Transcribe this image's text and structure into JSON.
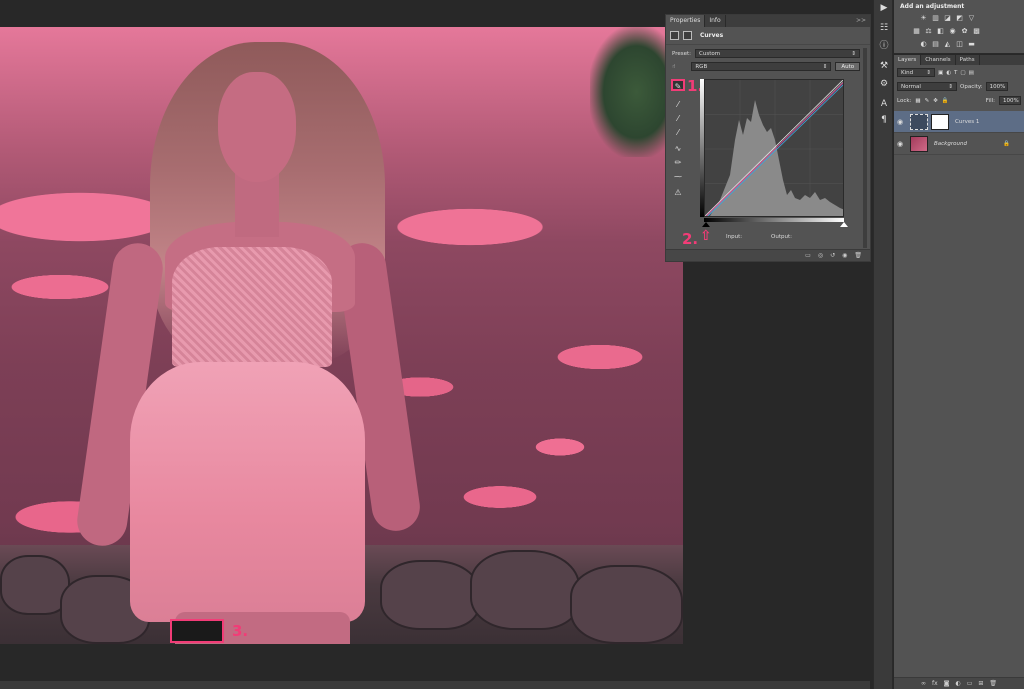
{
  "properties_panel": {
    "tabs": [
      "Properties",
      "Info"
    ],
    "collapse_icon": ">>",
    "menu_icon": "≡",
    "title": "Curves",
    "preset_label": "Preset:",
    "preset_value": "Custom",
    "channel_value": "RGB",
    "auto_button": "Auto",
    "input_label": "Input:",
    "output_label": "Output:",
    "tools": [
      "adjust-on-image-icon",
      "black-point-eyedropper-icon",
      "gray-point-eyedropper-icon",
      "white-point-eyedropper-icon",
      "curve-points-icon",
      "pencil-draw-icon",
      "smooth-icon",
      "clipping-warning-icon"
    ]
  },
  "annotations": {
    "one": "1.",
    "two": "2.",
    "three": "3."
  },
  "adjustments_panel": {
    "title": "Add an adjustment"
  },
  "layers_panel": {
    "tabs": [
      "Layers",
      "Channels",
      "Paths"
    ],
    "kind_filter": "Kind",
    "blend_mode": "Normal",
    "opacity_label": "Opacity:",
    "opacity_value": "100%",
    "lock_label": "Lock:",
    "fill_label": "Fill:",
    "fill_value": "100%",
    "layers": [
      {
        "name": "Curves 1",
        "selected": true
      },
      {
        "name": "Background",
        "selected": false,
        "locked": true
      }
    ],
    "footer_icons": [
      "link-icon",
      "fx-icon",
      "mask-icon",
      "adjustment-icon",
      "group-icon",
      "new-layer-icon",
      "trash-icon"
    ]
  },
  "colors": {
    "accent": "#f23c77",
    "panel": "#535353",
    "selected_layer": "#5d6d86"
  }
}
